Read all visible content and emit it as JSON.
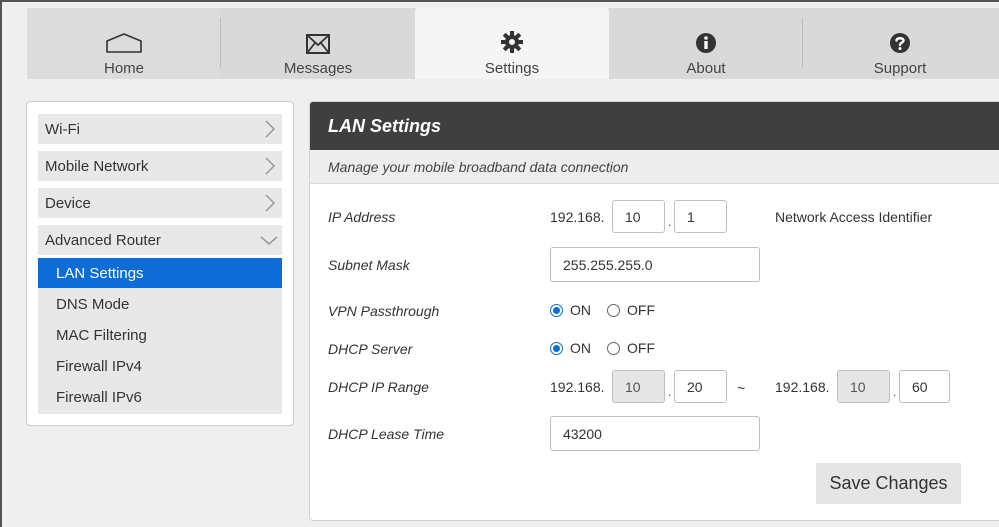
{
  "nav": {
    "tabs": [
      {
        "label": "Home",
        "icon": "home-icon"
      },
      {
        "label": "Messages",
        "icon": "envelope-icon"
      },
      {
        "label": "Settings",
        "icon": "gear-icon"
      },
      {
        "label": "About",
        "icon": "info-icon"
      },
      {
        "label": "Support",
        "icon": "question-icon"
      }
    ],
    "active": "Settings"
  },
  "sidebar": {
    "items": [
      {
        "label": "Wi-Fi"
      },
      {
        "label": "Mobile Network"
      },
      {
        "label": "Device"
      },
      {
        "label": "Advanced Router"
      }
    ],
    "submenu": [
      {
        "label": "LAN Settings"
      },
      {
        "label": "DNS Mode"
      },
      {
        "label": "MAC Filtering"
      },
      {
        "label": "Firewall IPv4"
      },
      {
        "label": "Firewall IPv6"
      }
    ],
    "active_sub": "LAN Settings"
  },
  "panel": {
    "title": "LAN Settings",
    "subtitle": "Manage your mobile broadband data connection",
    "ip_address": {
      "label": "IP Address",
      "prefix": "192.168.",
      "octet3": "10",
      "octet4": "1",
      "note": "Network Access Identifier"
    },
    "subnet_mask": {
      "label": "Subnet Mask",
      "value": "255.255.255.0"
    },
    "vpn_passthrough": {
      "label": "VPN Passthrough",
      "on_label": "ON",
      "off_label": "OFF",
      "selected": "ON"
    },
    "dhcp_server": {
      "label": "DHCP Server",
      "on_label": "ON",
      "off_label": "OFF",
      "selected": "ON"
    },
    "dhcp_ip_range": {
      "label": "DHCP IP Range",
      "start_prefix": "192.168.",
      "start_octet3": "10",
      "start_octet4": "20",
      "separator": "~",
      "end_prefix": "192.168.",
      "end_octet3": "10",
      "end_octet4": "60"
    },
    "dhcp_lease_time": {
      "label": "DHCP Lease Time",
      "value": "43200"
    },
    "save_label": "Save Changes"
  },
  "colors": {
    "accent": "#0d6cd5",
    "header": "#3f3f3f"
  }
}
